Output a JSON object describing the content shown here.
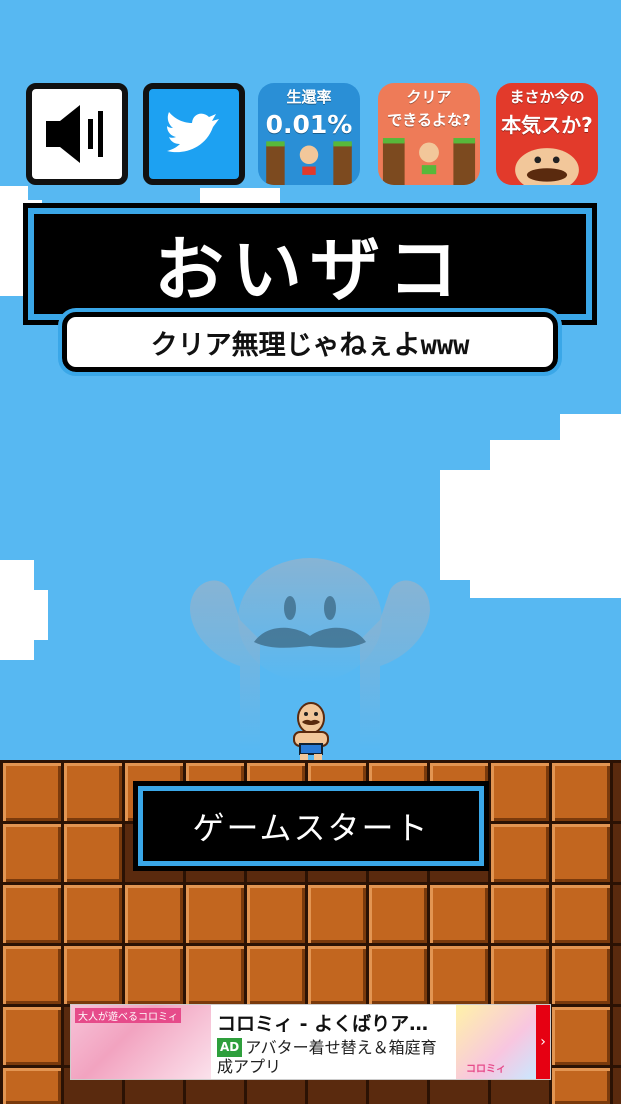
{
  "toolbar": {
    "sound_icon": "speaker-icon",
    "twitter_icon": "bird-icon"
  },
  "promo_apps": [
    {
      "line1": "生還率",
      "line2": "0.01%",
      "bg": "#2a8fd6"
    },
    {
      "line1": "クリア",
      "line2": "できるよな?",
      "bg": "#ee7b58"
    },
    {
      "line1": "まさか今の",
      "line2": "本気スか?",
      "bg": "#e23a2b"
    }
  ],
  "title": {
    "main": "おいザコ",
    "sub": "クリア無理じゃねぇよwww"
  },
  "start_button": {
    "label": "ゲームスタート"
  },
  "ad": {
    "thumb_caption": "大人が遊べるコロミィ",
    "title": "コロミィ - よくばりア…",
    "tag": "AD",
    "description": "アバター着せ替え＆箱庭育成アプリ",
    "thumb_right_caption": "コロミィ"
  },
  "colors": {
    "sky": "#57b8f2",
    "accent_border": "#3aa7e8",
    "brick": "#c2661f"
  }
}
